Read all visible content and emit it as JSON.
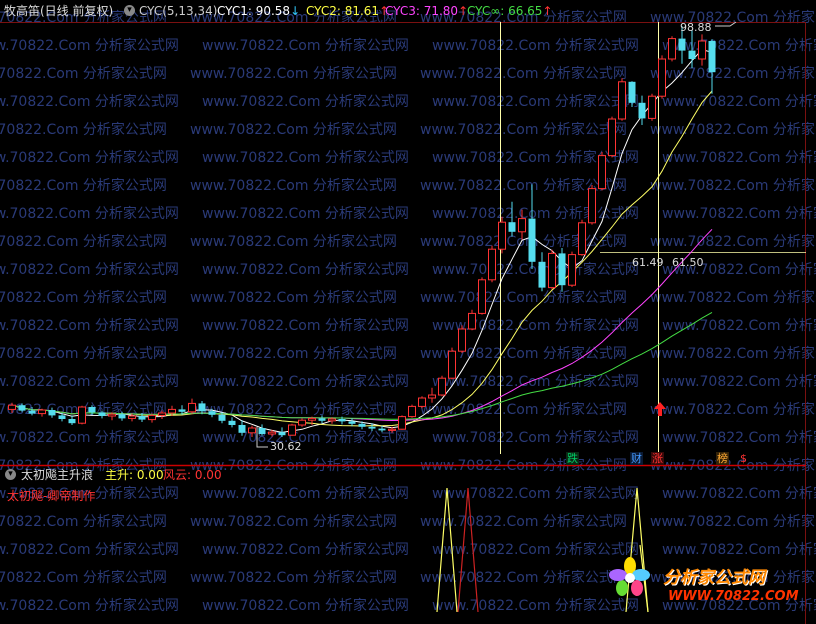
{
  "header": {
    "indicator_name": "牧高笛(日线 前复权)",
    "cyc_label": "CYC(5,13,34)",
    "cyc1_label": "CYC1: 90.58",
    "cyc1_arrow": "↓",
    "cyc2_label": "CYC2: 81.61",
    "cyc2_arrow": "↑",
    "cyc3_label": "CYC3: 71.80",
    "cyc3_arrow": "↑",
    "cycinf_label": "CYC∞: 66.65",
    "cycinf_arrow": "↑"
  },
  "annotations": {
    "high_value": "98.88",
    "low_value": "30.62",
    "crosshair_left": "61.49",
    "crosshair_right": "61.50"
  },
  "event_tags": [
    {
      "text": "跌",
      "color": "#00cc66"
    },
    {
      "text": "财",
      "color": "#3388ff"
    },
    {
      "text": "涨",
      "color": "#ff3333"
    },
    {
      "text": "榜",
      "color": "#ffaa33"
    },
    {
      "text": "$",
      "color": "#ff3333"
    }
  ],
  "lower": {
    "title": "太初飚主升浪",
    "zhusheng_label": "主升: 0.00",
    "fengyun_label": "风云: 0.00",
    "author": "太初飚-卿帝制作"
  },
  "logo": {
    "name": "分析家公式网",
    "url": "WWW.70822.COM"
  },
  "watermark": "www.70822.Com 分析家公式网",
  "colors": {
    "up": "#ff3333",
    "down": "#55ddee",
    "cyc1": "#ffffff",
    "cyc2": "#ffff66",
    "cyc3": "#ff44ff",
    "cycinf": "#44dd44",
    "crosshair": "#ffffaa",
    "divider": "#cc0000"
  },
  "chart_data": {
    "type": "candlestick",
    "series_names": [
      "CYC1",
      "CYC2",
      "CYC3",
      "CYC∞"
    ],
    "candles": [
      [
        35.2,
        36.3,
        34.6,
        35.9
      ],
      [
        35.9,
        36.2,
        34.8,
        35.0
      ],
      [
        35.0,
        35.6,
        34.2,
        34.5
      ],
      [
        34.5,
        35.3,
        34.0,
        35.1
      ],
      [
        35.1,
        35.5,
        33.8,
        34.2
      ],
      [
        34.2,
        34.6,
        33.2,
        33.6
      ],
      [
        33.6,
        34.2,
        32.6,
        32.9
      ],
      [
        32.9,
        35.8,
        32.7,
        35.6
      ],
      [
        35.6,
        35.9,
        34.3,
        34.7
      ],
      [
        34.7,
        35.0,
        33.7,
        34.1
      ],
      [
        34.1,
        34.7,
        33.4,
        34.4
      ],
      [
        34.4,
        34.8,
        33.3,
        33.7
      ],
      [
        33.7,
        34.5,
        33.2,
        34.1
      ],
      [
        34.1,
        34.6,
        33.1,
        33.5
      ],
      [
        33.5,
        34.5,
        33.0,
        34.2
      ],
      [
        34.2,
        35.0,
        33.6,
        34.6
      ],
      [
        34.6,
        35.8,
        34.1,
        35.2
      ],
      [
        35.2,
        35.9,
        34.3,
        34.8
      ],
      [
        34.8,
        37.0,
        34.5,
        36.2
      ],
      [
        36.2,
        36.6,
        34.4,
        34.9
      ],
      [
        34.9,
        35.3,
        33.9,
        34.3
      ],
      [
        34.3,
        34.7,
        32.9,
        33.3
      ],
      [
        33.3,
        33.9,
        32.2,
        32.6
      ],
      [
        32.6,
        33.4,
        30.8,
        31.3
      ],
      [
        31.3,
        32.5,
        30.6,
        32.1
      ],
      [
        32.1,
        32.7,
        30.8,
        31.1
      ],
      [
        31.1,
        31.8,
        30.7,
        31.4
      ],
      [
        31.4,
        32.2,
        30.6,
        30.9
      ],
      [
        30.9,
        32.8,
        30.8,
        32.6
      ],
      [
        32.6,
        33.7,
        32.3,
        33.4
      ],
      [
        33.4,
        34.0,
        32.6,
        33.7
      ],
      [
        33.7,
        34.2,
        32.9,
        33.3
      ],
      [
        33.3,
        33.9,
        32.8,
        33.6
      ],
      [
        33.6,
        34.0,
        32.7,
        33.2
      ],
      [
        33.2,
        33.7,
        32.4,
        32.8
      ],
      [
        32.8,
        33.2,
        31.9,
        32.3
      ],
      [
        32.3,
        32.9,
        31.6,
        32.0
      ],
      [
        32.0,
        32.5,
        31.4,
        31.7
      ],
      [
        31.7,
        32.3,
        31.3,
        31.9
      ],
      [
        31.9,
        34.2,
        31.8,
        34.0
      ],
      [
        34.0,
        36.0,
        33.8,
        35.7
      ],
      [
        35.7,
        37.4,
        35.4,
        37.1
      ],
      [
        37.1,
        38.8,
        36.3,
        37.6
      ],
      [
        37.6,
        40.8,
        37.4,
        40.4
      ],
      [
        40.4,
        45.5,
        40.2,
        44.9
      ],
      [
        44.9,
        49.2,
        44.6,
        48.6
      ],
      [
        48.6,
        51.8,
        48.4,
        51.2
      ],
      [
        51.2,
        57.2,
        51.0,
        56.8
      ],
      [
        56.8,
        62.5,
        56.4,
        61.9
      ],
      [
        61.9,
        67.3,
        61.2,
        66.4
      ],
      [
        66.4,
        69.8,
        64.0,
        64.8
      ],
      [
        64.8,
        68.5,
        63.5,
        67.0
      ],
      [
        67.0,
        72.7,
        58.6,
        59.8
      ],
      [
        59.8,
        61.4,
        54.9,
        55.5
      ],
      [
        55.5,
        61.8,
        55.2,
        61.2
      ],
      [
        61.2,
        62.1,
        54.8,
        55.9
      ],
      [
        55.9,
        61.5,
        55.6,
        61.0
      ],
      [
        61.0,
        66.8,
        60.8,
        66.3
      ],
      [
        66.3,
        72.6,
        66.0,
        72.0
      ],
      [
        72.0,
        78.1,
        71.7,
        77.5
      ],
      [
        77.5,
        84.0,
        77.2,
        83.6
      ],
      [
        83.6,
        90.4,
        83.3,
        89.8
      ],
      [
        89.8,
        89.9,
        85.6,
        86.3
      ],
      [
        86.3,
        87.5,
        82.6,
        83.7
      ],
      [
        83.7,
        87.8,
        83.3,
        87.4
      ],
      [
        87.4,
        94.2,
        87.0,
        93.6
      ],
      [
        93.6,
        97.4,
        93.2,
        97.0
      ],
      [
        97.0,
        99.1,
        92.8,
        95.0
      ],
      [
        95.0,
        98.4,
        92.1,
        93.6
      ],
      [
        93.6,
        97.7,
        92.5,
        96.6
      ],
      [
        96.6,
        96.9,
        87.8,
        91.4
      ]
    ]
  }
}
